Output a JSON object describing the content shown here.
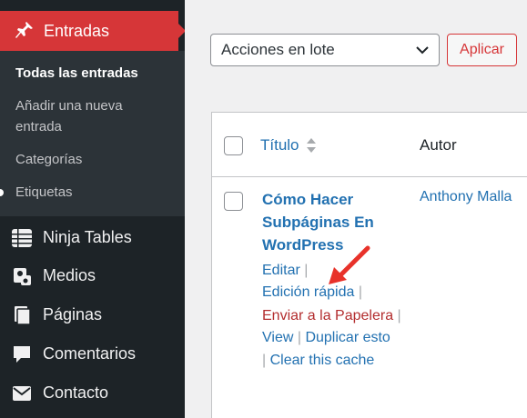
{
  "sidebar": {
    "active_menu": {
      "label": "Entradas",
      "icon": "pushpin-icon"
    },
    "submenu": [
      {
        "label": "Todas las entradas",
        "current": true
      },
      {
        "label": "Añadir una nueva",
        "current": false
      },
      {
        "label": "entrada",
        "current": false
      },
      {
        "label": "Categorías",
        "current": false
      },
      {
        "label": "Etiquetas",
        "current": false
      }
    ],
    "items": [
      {
        "label": "Ninja Tables",
        "icon": "table-icon"
      },
      {
        "label": "Medios",
        "icon": "media-icon"
      },
      {
        "label": "Páginas",
        "icon": "pages-icon"
      },
      {
        "label": "Comentarios",
        "icon": "comment-icon"
      },
      {
        "label": "Contacto",
        "icon": "mail-icon"
      }
    ]
  },
  "toolbar": {
    "bulk_actions": "Acciones en lote",
    "apply_label": "Aplicar"
  },
  "table": {
    "columns": [
      "Título",
      "Autor"
    ],
    "row": {
      "title_lines": [
        "Cómo Hacer",
        "Subpáginas En",
        "WordPress"
      ],
      "author": "Anthony Malla",
      "actions": {
        "edit": "Editar",
        "quick_edit": "Edición rápida",
        "trash": "Enviar a la Papelera",
        "view": "View",
        "duplicate": "Duplicar esto",
        "clear_cache": "Clear this cache"
      },
      "separator": "|"
    }
  },
  "colors": {
    "sidebar_bg": "#1d2327",
    "submenu_bg": "#2c3338",
    "active_red": "#d63638",
    "link_blue": "#2271b1",
    "trash_red": "#b32d2e",
    "annotation_arrow": "#e8322a"
  }
}
